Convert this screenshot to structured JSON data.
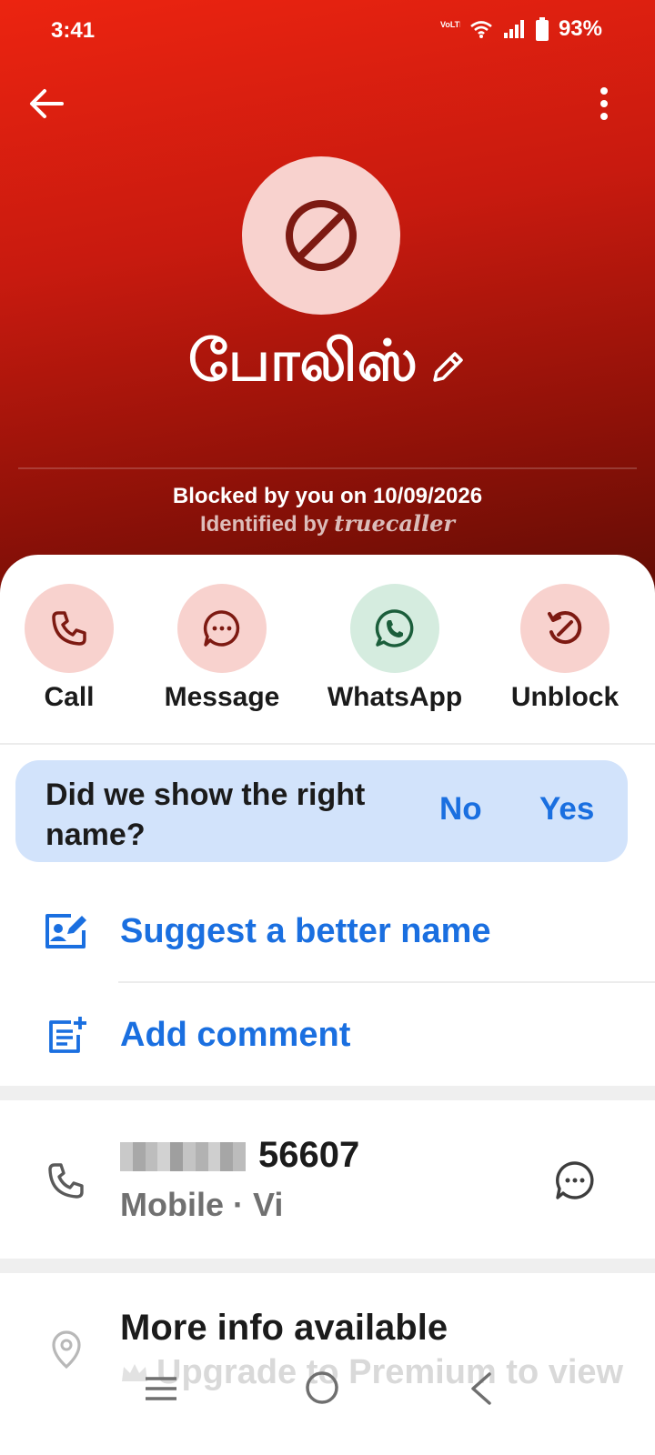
{
  "status_bar": {
    "time": "3:41",
    "network_label": "VoLTE",
    "battery": "93%"
  },
  "header": {
    "back_icon": "arrow-left-icon",
    "more_icon": "more-vertical-icon"
  },
  "contact": {
    "avatar_icon": "blocked-icon",
    "name": "போலிஸ்",
    "blocked_text": "Blocked by you on 10/09/2026",
    "identified_prefix": "Identified by",
    "brand": "truecaller"
  },
  "actions": [
    {
      "label": "Call",
      "icon": "phone-icon"
    },
    {
      "label": "Message",
      "icon": "chat-bubble-icon"
    },
    {
      "label": "WhatsApp",
      "icon": "whatsapp-icon"
    },
    {
      "label": "Unblock",
      "icon": "unblock-icon"
    }
  ],
  "feedback": {
    "question": "Did we show the right name?",
    "no": "No",
    "yes": "Yes"
  },
  "links": {
    "suggest": "Suggest a better name",
    "comment": "Add comment"
  },
  "phone": {
    "number_suffix": "56607",
    "type": "Mobile · Vi"
  },
  "more_info": {
    "title": "More info available",
    "upgrade": "Upgrade to Premium to view"
  },
  "colors": {
    "accent_blue": "#1a6fe0",
    "hero_red": "#d41f10",
    "whatsapp_green": "#1b5e3b"
  }
}
